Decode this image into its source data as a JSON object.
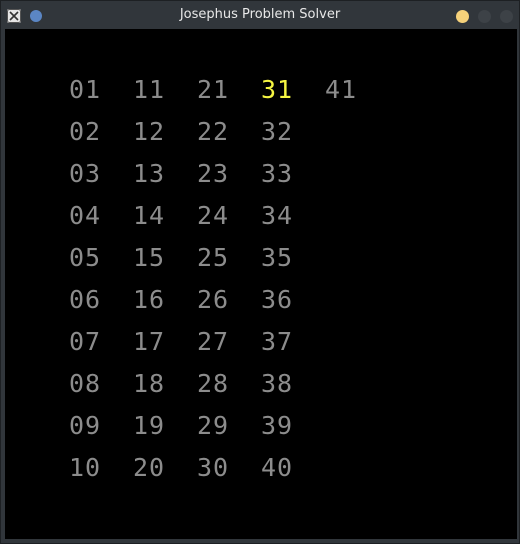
{
  "window": {
    "title": "Josephus Problem Solver",
    "app_icon": "x-app-icon",
    "buttons": [
      "pin",
      "minimize",
      "maximize",
      "close"
    ]
  },
  "colors": {
    "number_default": "#8c8c8c",
    "number_highlight": "#f5f542",
    "canvas_background": "#000000",
    "titlebar": "#31363b"
  },
  "grid": {
    "columns": [
      [
        "01",
        "02",
        "03",
        "04",
        "05",
        "06",
        "07",
        "08",
        "09",
        "10"
      ],
      [
        "11",
        "12",
        "13",
        "14",
        "15",
        "16",
        "17",
        "18",
        "19",
        "20"
      ],
      [
        "21",
        "22",
        "23",
        "24",
        "25",
        "26",
        "27",
        "28",
        "29",
        "30"
      ],
      [
        "31",
        "32",
        "33",
        "34",
        "35",
        "36",
        "37",
        "38",
        "39",
        "40"
      ],
      [
        "41"
      ]
    ],
    "highlighted": "31"
  }
}
